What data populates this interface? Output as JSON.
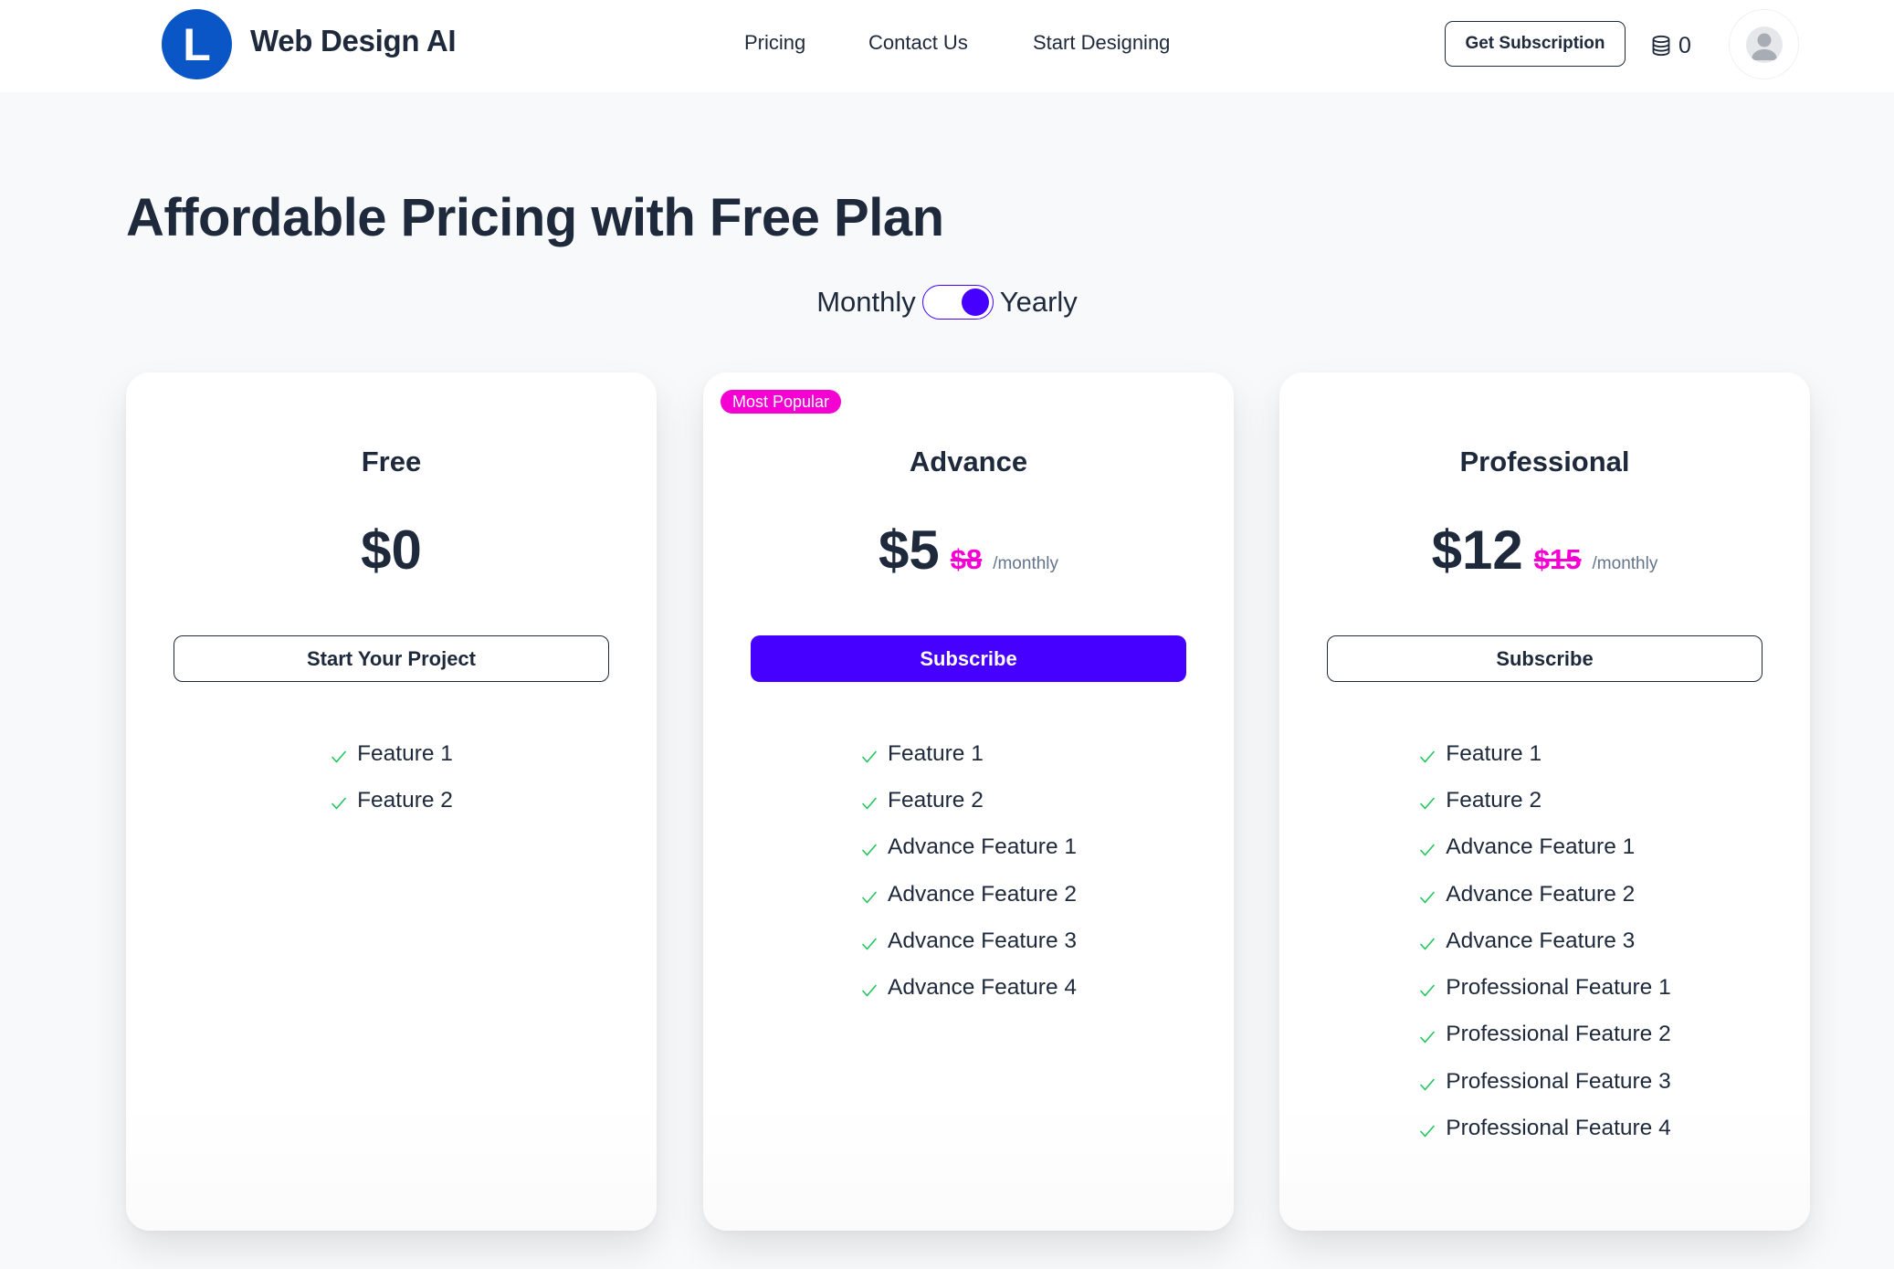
{
  "header": {
    "logo_letter": "L",
    "brand": "Web Design AI",
    "nav": [
      {
        "label": "Pricing"
      },
      {
        "label": "Contact Us"
      },
      {
        "label": "Start Designing"
      }
    ],
    "cta_label": "Get Subscription",
    "coin_icon": "database-icon",
    "coin_count": "0",
    "avatar_icon": "user-avatar-icon"
  },
  "page": {
    "title": "Affordable Pricing with Free Plan",
    "billing": {
      "left_label": "Monthly",
      "right_label": "Yearly",
      "selected": "Yearly"
    }
  },
  "colors": {
    "accent": "#4600ff",
    "highlight": "#f500d3",
    "check": "#22c55e",
    "text": "#1e293b",
    "logo": "#0a56c6"
  },
  "plans": [
    {
      "name": "Free",
      "price": "$0",
      "old_price": "",
      "period": "",
      "badge": "",
      "button_label": "Start Your Project",
      "button_style": "outline",
      "features": [
        "Feature 1",
        "Feature 2"
      ]
    },
    {
      "name": "Advance",
      "price": "$5",
      "old_price": "$8",
      "period": "/monthly",
      "badge": "Most Popular",
      "button_label": "Subscribe",
      "button_style": "filled",
      "features": [
        "Feature 1",
        "Feature 2",
        "Advance Feature 1",
        "Advance Feature 2",
        "Advance Feature 3",
        "Advance Feature 4"
      ]
    },
    {
      "name": "Professional",
      "price": "$12",
      "old_price": "$15",
      "period": "/monthly",
      "badge": "",
      "button_label": "Subscribe",
      "button_style": "outline",
      "features": [
        "Feature 1",
        "Feature 2",
        "Advance Feature 1",
        "Advance Feature 2",
        "Advance Feature 3",
        "Professional Feature 1",
        "Professional Feature 2",
        "Professional Feature 3",
        "Professional Feature 4"
      ]
    }
  ]
}
